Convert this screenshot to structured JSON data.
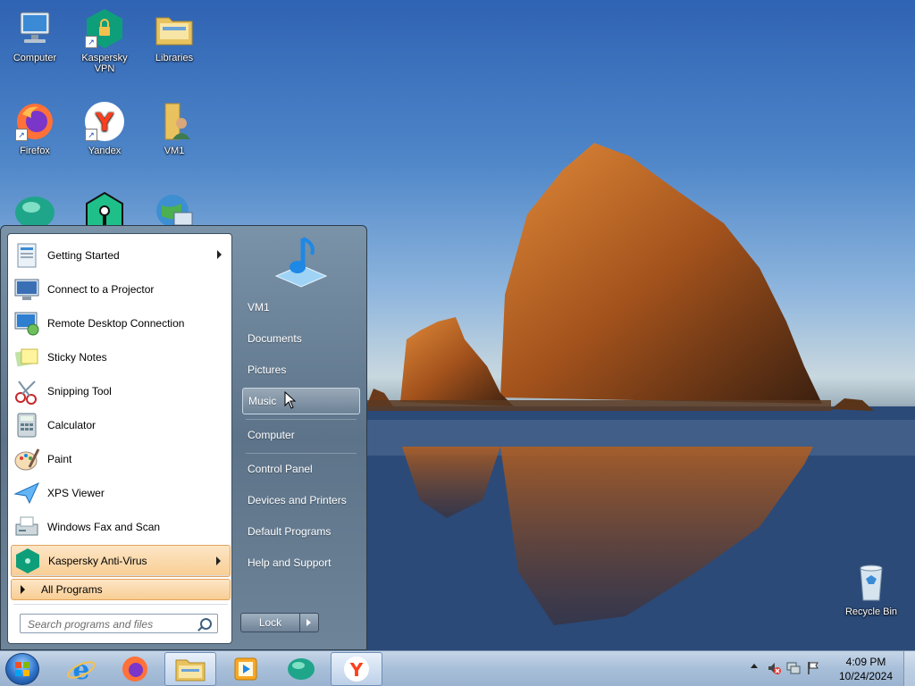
{
  "desktop": {
    "icons": [
      {
        "label": "Computer",
        "icon": "computer-icon"
      },
      {
        "label": "Kaspersky\nVPN",
        "icon": "kaspersky-vpn-icon"
      },
      {
        "label": "Libraries",
        "icon": "libraries-icon"
      },
      {
        "label": "Firefox",
        "icon": "firefox-icon"
      },
      {
        "label": "Yandex",
        "icon": "yandex-icon"
      },
      {
        "label": "VM1",
        "icon": "user-folder-icon"
      },
      {
        "label": "",
        "icon": "kaspersky-green-orb-icon"
      },
      {
        "label": "",
        "icon": "kaspersky-password-icon"
      },
      {
        "label": "",
        "icon": "network-globe-icon"
      },
      {
        "label": "Recycle Bin",
        "icon": "recycle-bin-icon"
      }
    ]
  },
  "start_menu": {
    "programs": [
      {
        "label": "Getting Started",
        "has_submenu": true,
        "icon": "getting-started-icon"
      },
      {
        "label": "Connect to a Projector",
        "has_submenu": false,
        "icon": "projector-icon"
      },
      {
        "label": "Remote Desktop Connection",
        "has_submenu": false,
        "icon": "remote-desktop-icon"
      },
      {
        "label": "Sticky Notes",
        "has_submenu": false,
        "icon": "sticky-notes-icon"
      },
      {
        "label": "Snipping Tool",
        "has_submenu": false,
        "icon": "scissors-icon"
      },
      {
        "label": "Calculator",
        "has_submenu": false,
        "icon": "calculator-icon"
      },
      {
        "label": "Paint",
        "has_submenu": false,
        "icon": "paint-palette-icon"
      },
      {
        "label": "XPS Viewer",
        "has_submenu": false,
        "icon": "xps-viewer-icon"
      },
      {
        "label": "Windows Fax and Scan",
        "has_submenu": false,
        "icon": "fax-scan-icon"
      },
      {
        "label": "Kaspersky Anti-Virus",
        "has_submenu": true,
        "icon": "kaspersky-icon"
      }
    ],
    "all_programs": "All Programs",
    "search_placeholder": "Search programs and files",
    "right_items": [
      {
        "label": "VM1"
      },
      {
        "label": "Documents"
      },
      {
        "label": "Pictures"
      },
      {
        "label": "Music"
      },
      {
        "label": "Computer"
      },
      {
        "label": "Control Panel"
      },
      {
        "label": "Devices and Printers"
      },
      {
        "label": "Default Programs"
      },
      {
        "label": "Help and Support"
      }
    ],
    "highlighted_right_item": "Music",
    "user_picture_icon": "music-note-icon",
    "lock_label": "Lock"
  },
  "taskbar": {
    "pinned": [
      {
        "icon": "internet-explorer-icon"
      },
      {
        "icon": "firefox-icon"
      },
      {
        "icon": "windows-explorer-icon"
      },
      {
        "icon": "media-player-icon"
      },
      {
        "icon": "kaspersky-green-orb-icon"
      },
      {
        "icon": "yandex-icon"
      }
    ],
    "time": "4:09 PM",
    "date": "10/24/2024"
  },
  "colors": {
    "start_menu_bg": "#6e8498",
    "highlight_orange": "#f8cd93",
    "kaspersky_green": "#0f9e7a"
  }
}
